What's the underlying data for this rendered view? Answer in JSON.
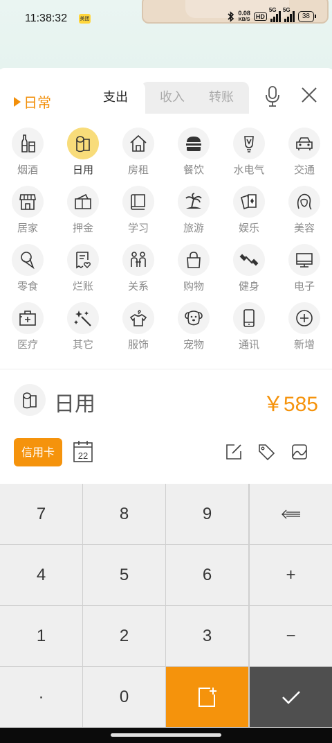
{
  "status_bar": {
    "time": "11:38:32",
    "app_badge": "美团",
    "net_speed_value": "0.08",
    "net_speed_unit": "KB/S",
    "hd_label": "HD",
    "sig1_label": "5G",
    "sig2_label": "5G",
    "battery": "38"
  },
  "header": {
    "book": "日常",
    "tabs": [
      "支出",
      "收入",
      "转账"
    ],
    "active_tab": "支出"
  },
  "categories": [
    {
      "label": "烟酒",
      "icon": "wine-bottles-icon"
    },
    {
      "label": "日用",
      "icon": "tissue-roll-icon",
      "selected": true
    },
    {
      "label": "房租",
      "icon": "house-icon"
    },
    {
      "label": "餐饮",
      "icon": "burger-icon"
    },
    {
      "label": "水电气",
      "icon": "bulb-icon"
    },
    {
      "label": "交通",
      "icon": "car-icon"
    },
    {
      "label": "居家",
      "icon": "storefront-icon"
    },
    {
      "label": "押金",
      "icon": "wallet-icon"
    },
    {
      "label": "学习",
      "icon": "book-icon"
    },
    {
      "label": "旅游",
      "icon": "palm-island-icon"
    },
    {
      "label": "娱乐",
      "icon": "playing-cards-icon"
    },
    {
      "label": "美容",
      "icon": "woman-face-icon"
    },
    {
      "label": "零食",
      "icon": "ice-cream-icon"
    },
    {
      "label": "烂账",
      "icon": "receipt-heart-icon"
    },
    {
      "label": "关系",
      "icon": "two-people-icon"
    },
    {
      "label": "购物",
      "icon": "shopping-bag-icon"
    },
    {
      "label": "健身",
      "icon": "dumbbell-icon"
    },
    {
      "label": "电子",
      "icon": "monitor-icon"
    },
    {
      "label": "医疗",
      "icon": "medical-kit-icon"
    },
    {
      "label": "其它",
      "icon": "magic-wand-icon"
    },
    {
      "label": "服饰",
      "icon": "shirt-hanger-icon"
    },
    {
      "label": "宠物",
      "icon": "dog-face-icon"
    },
    {
      "label": "通讯",
      "icon": "phone-icon"
    },
    {
      "label": "新增",
      "icon": "add-circle-icon"
    }
  ],
  "entry": {
    "category": "日用",
    "amount": "￥585"
  },
  "tools": {
    "account": "信用卡",
    "date_day": "22"
  },
  "keypad": {
    "keys": [
      "7",
      "8",
      "9",
      "⇐",
      "4",
      "5",
      "6",
      "+",
      "1",
      "2",
      "3",
      "−",
      "·",
      "0",
      "",
      ""
    ]
  },
  "colors": {
    "accent": "#f5930c",
    "selected_circle": "#f8dc7a",
    "confirm_key": "#4f4f4f"
  }
}
